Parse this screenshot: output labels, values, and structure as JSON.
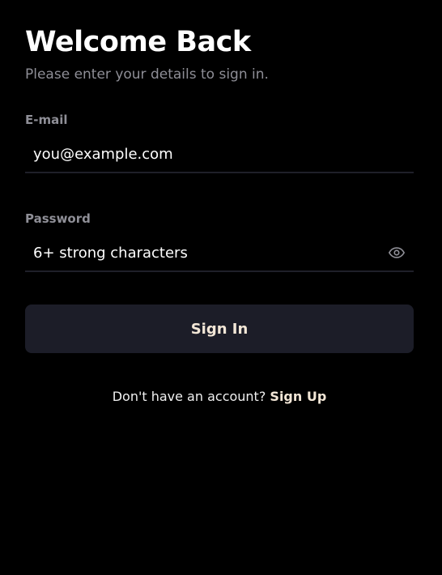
{
  "header": {
    "title": "Welcome Back",
    "subtitle": "Please enter your details to sign in."
  },
  "form": {
    "email": {
      "label": "E-mail",
      "placeholder": "you@example.com",
      "value": ""
    },
    "password": {
      "label": "Password",
      "placeholder": "6+ strong characters",
      "value": "",
      "toggle_icon": "eye-icon"
    },
    "submit_label": "Sign In"
  },
  "footer": {
    "prompt": "Don't have an account?",
    "link_label": "Sign Up"
  },
  "colors": {
    "background": "#000000",
    "muted_text": "#8e8e96",
    "button_bg": "#1c1d28",
    "accent_text": "#f2e6d6",
    "divider": "#1f2029"
  }
}
